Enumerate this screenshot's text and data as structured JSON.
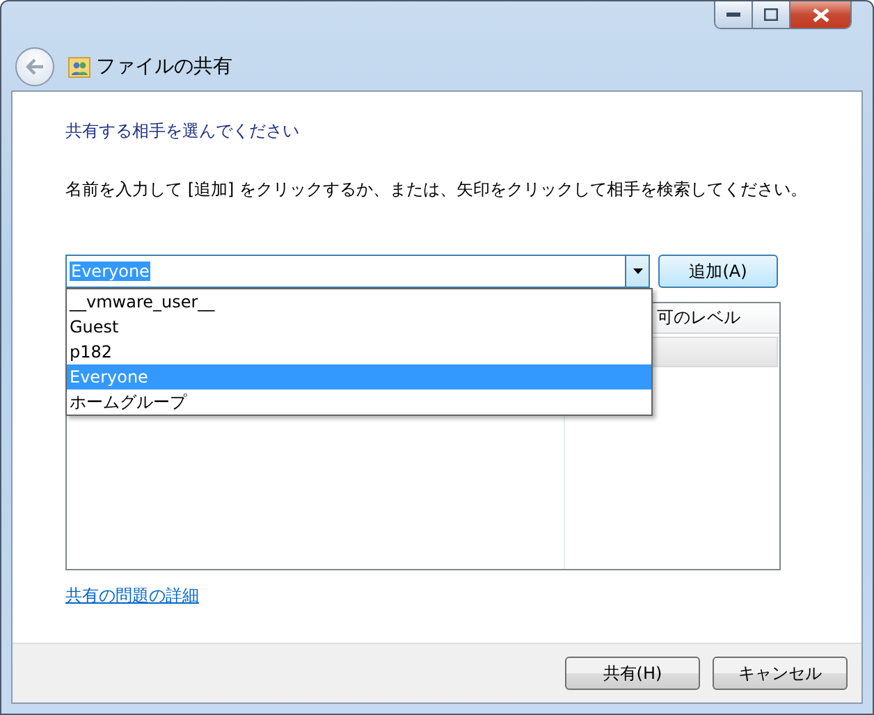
{
  "window": {
    "title": "ファイルの共有"
  },
  "heading": "共有する相手を選んでください",
  "instruction": "名前を入力して [追加] をクリックするか、または、矢印をクリックして相手を検索してください。",
  "name_combobox": {
    "value": "Everyone",
    "expanded": true
  },
  "add_button": "追加(A)",
  "dropdown_items": [
    {
      "label": "__vmware_user__",
      "selected": false
    },
    {
      "label": "Guest",
      "selected": false
    },
    {
      "label": "p182",
      "selected": false
    },
    {
      "label": "Everyone",
      "selected": true
    },
    {
      "label": "ホームグループ",
      "selected": false
    }
  ],
  "table": {
    "column_2": "可のレベル"
  },
  "link": "共有の問題の詳細",
  "buttons": [
    "共有(H)",
    "キャンセル"
  ]
}
